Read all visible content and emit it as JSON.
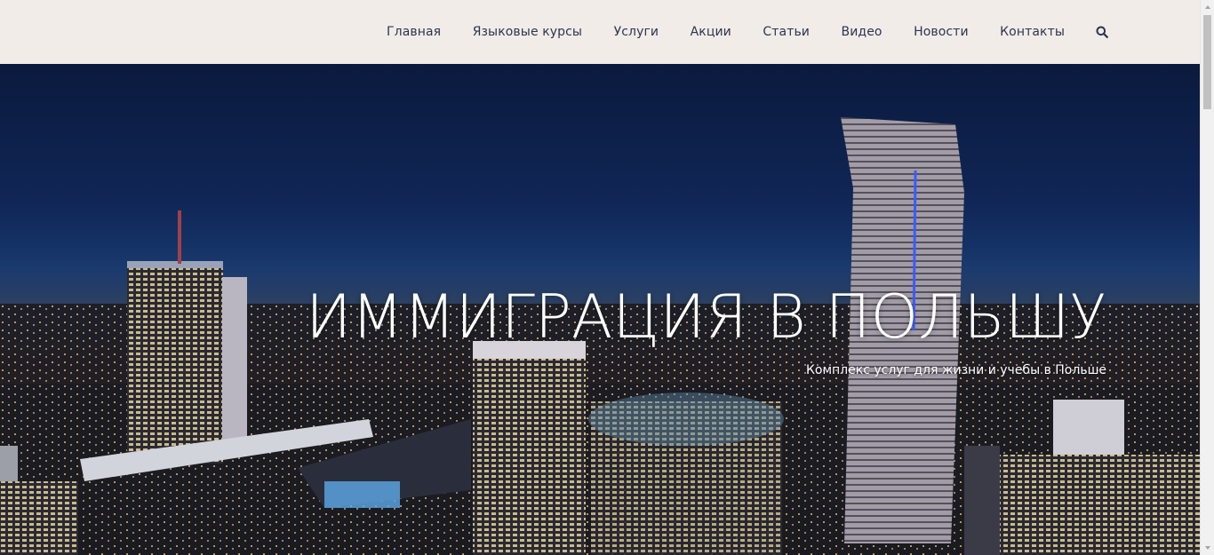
{
  "nav": {
    "items": [
      {
        "label": "Главная"
      },
      {
        "label": "Языковые курсы"
      },
      {
        "label": "Услуги"
      },
      {
        "label": "Акции"
      },
      {
        "label": "Статьи"
      },
      {
        "label": "Видео"
      },
      {
        "label": "Новости"
      },
      {
        "label": "Контакты"
      }
    ],
    "search_icon": "search-icon"
  },
  "hero": {
    "title": "ИММИГРАЦИЯ В ПОЛЬШУ",
    "subtitle": "Комплекс услуг для жизни и учебы в Польше",
    "image": "night-city-skyline"
  },
  "colors": {
    "navbar_bg": "#f2ece8",
    "nav_text": "#2b3550",
    "hero_text": "#ffffff"
  }
}
